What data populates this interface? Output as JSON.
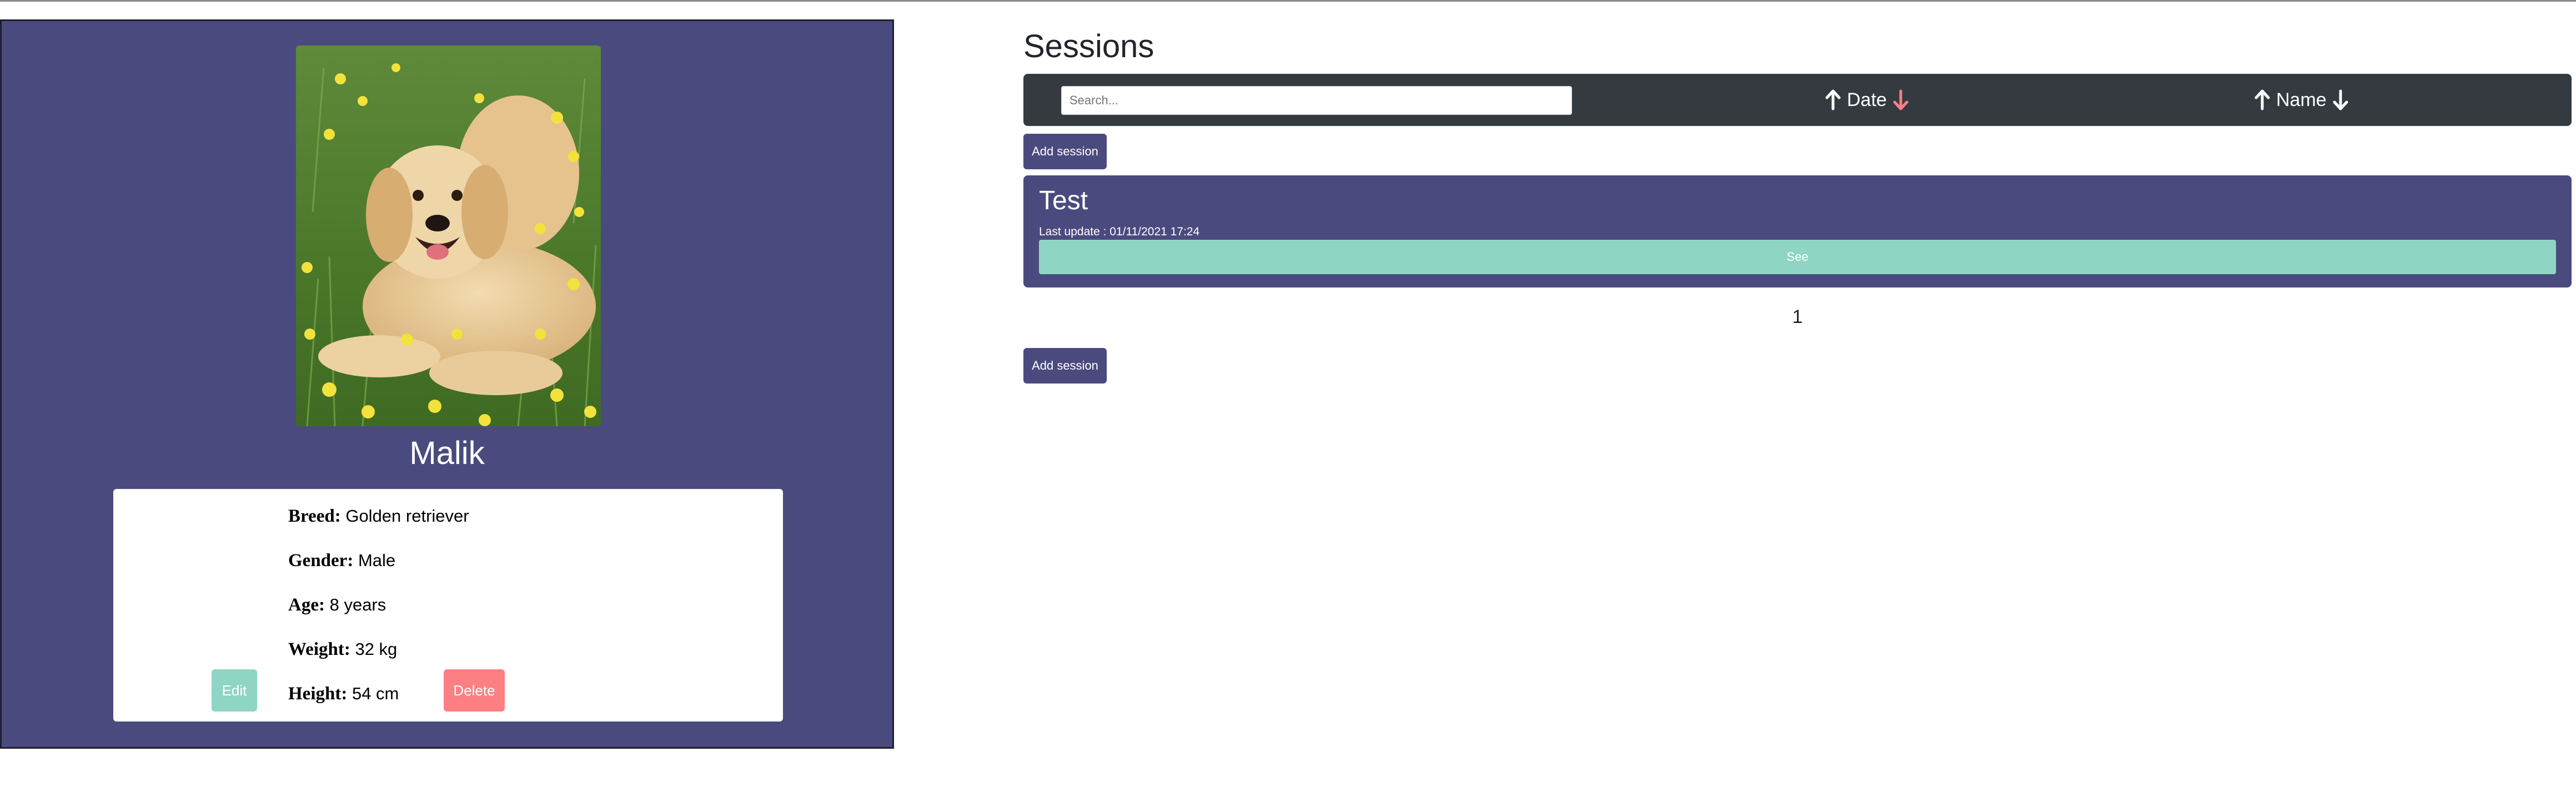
{
  "profile": {
    "name": "Malik",
    "photo_alt": "dog photo",
    "fields": [
      {
        "label": "Breed:",
        "value": "Golden retriever"
      },
      {
        "label": "Gender:",
        "value": "Male"
      },
      {
        "label": "Age:",
        "value": "8 years"
      },
      {
        "label": "Weight:",
        "value": "32 kg"
      },
      {
        "label": "Height:",
        "value": "54 cm"
      }
    ],
    "edit_label": "Edit",
    "delete_label": "Delete"
  },
  "sessions": {
    "title": "Sessions",
    "search_placeholder": "Search...",
    "sort_date_label": "Date",
    "sort_name_label": "Name",
    "add_session_label": "Add session",
    "items": [
      {
        "name": "Test",
        "last_update": "Last update : 01/11/2021 17:24",
        "see_label": "See"
      }
    ],
    "pagination": {
      "current_page": "1"
    }
  },
  "colors": {
    "panel": "#4b4a7e",
    "toolbar": "#343a40",
    "teal": "#8fd5c3",
    "coral": "#fc7f84",
    "active_sort_arrow": "#fc7f84"
  },
  "icons": [
    "arrow-up-icon",
    "arrow-down-icon"
  ]
}
